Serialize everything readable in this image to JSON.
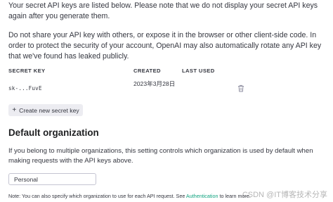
{
  "intro": {
    "line1": "Your secret API keys are listed below. Please note that we do not display your secret API keys again after you generate them.",
    "line2": "Do not share your API key with others, or expose it in the browser or other client-side code. In order to protect the security of your account, OpenAI may also automatically rotate any API key that we've found has leaked publicly."
  },
  "keys_table": {
    "headers": {
      "secret_key": "SECRET KEY",
      "created": "CREATED",
      "last_used": "LAST USED"
    },
    "rows": [
      {
        "key": "sk-...FuvE",
        "created": "2023年3月28日",
        "last_used": ""
      }
    ]
  },
  "create_button": {
    "icon": "+",
    "label": "Create new secret key"
  },
  "default_org": {
    "title": "Default organization",
    "description": "If you belong to multiple organizations, this setting controls which organization is used by default when making requests with the API keys above.",
    "selected": "Personal"
  },
  "note": {
    "prefix": "Note: You can also specify which organization to use for each API request. See ",
    "link": "Authentication",
    "suffix": " to learn more."
  },
  "watermark": "CSDN @IT博客技术分享",
  "colors": {
    "text": "#353740",
    "heading": "#202123",
    "button_bg": "#ececf1",
    "link": "#10a37f",
    "border": "#c5c5d2"
  },
  "icons": {
    "delete": "trash-icon",
    "add": "plus-icon"
  }
}
